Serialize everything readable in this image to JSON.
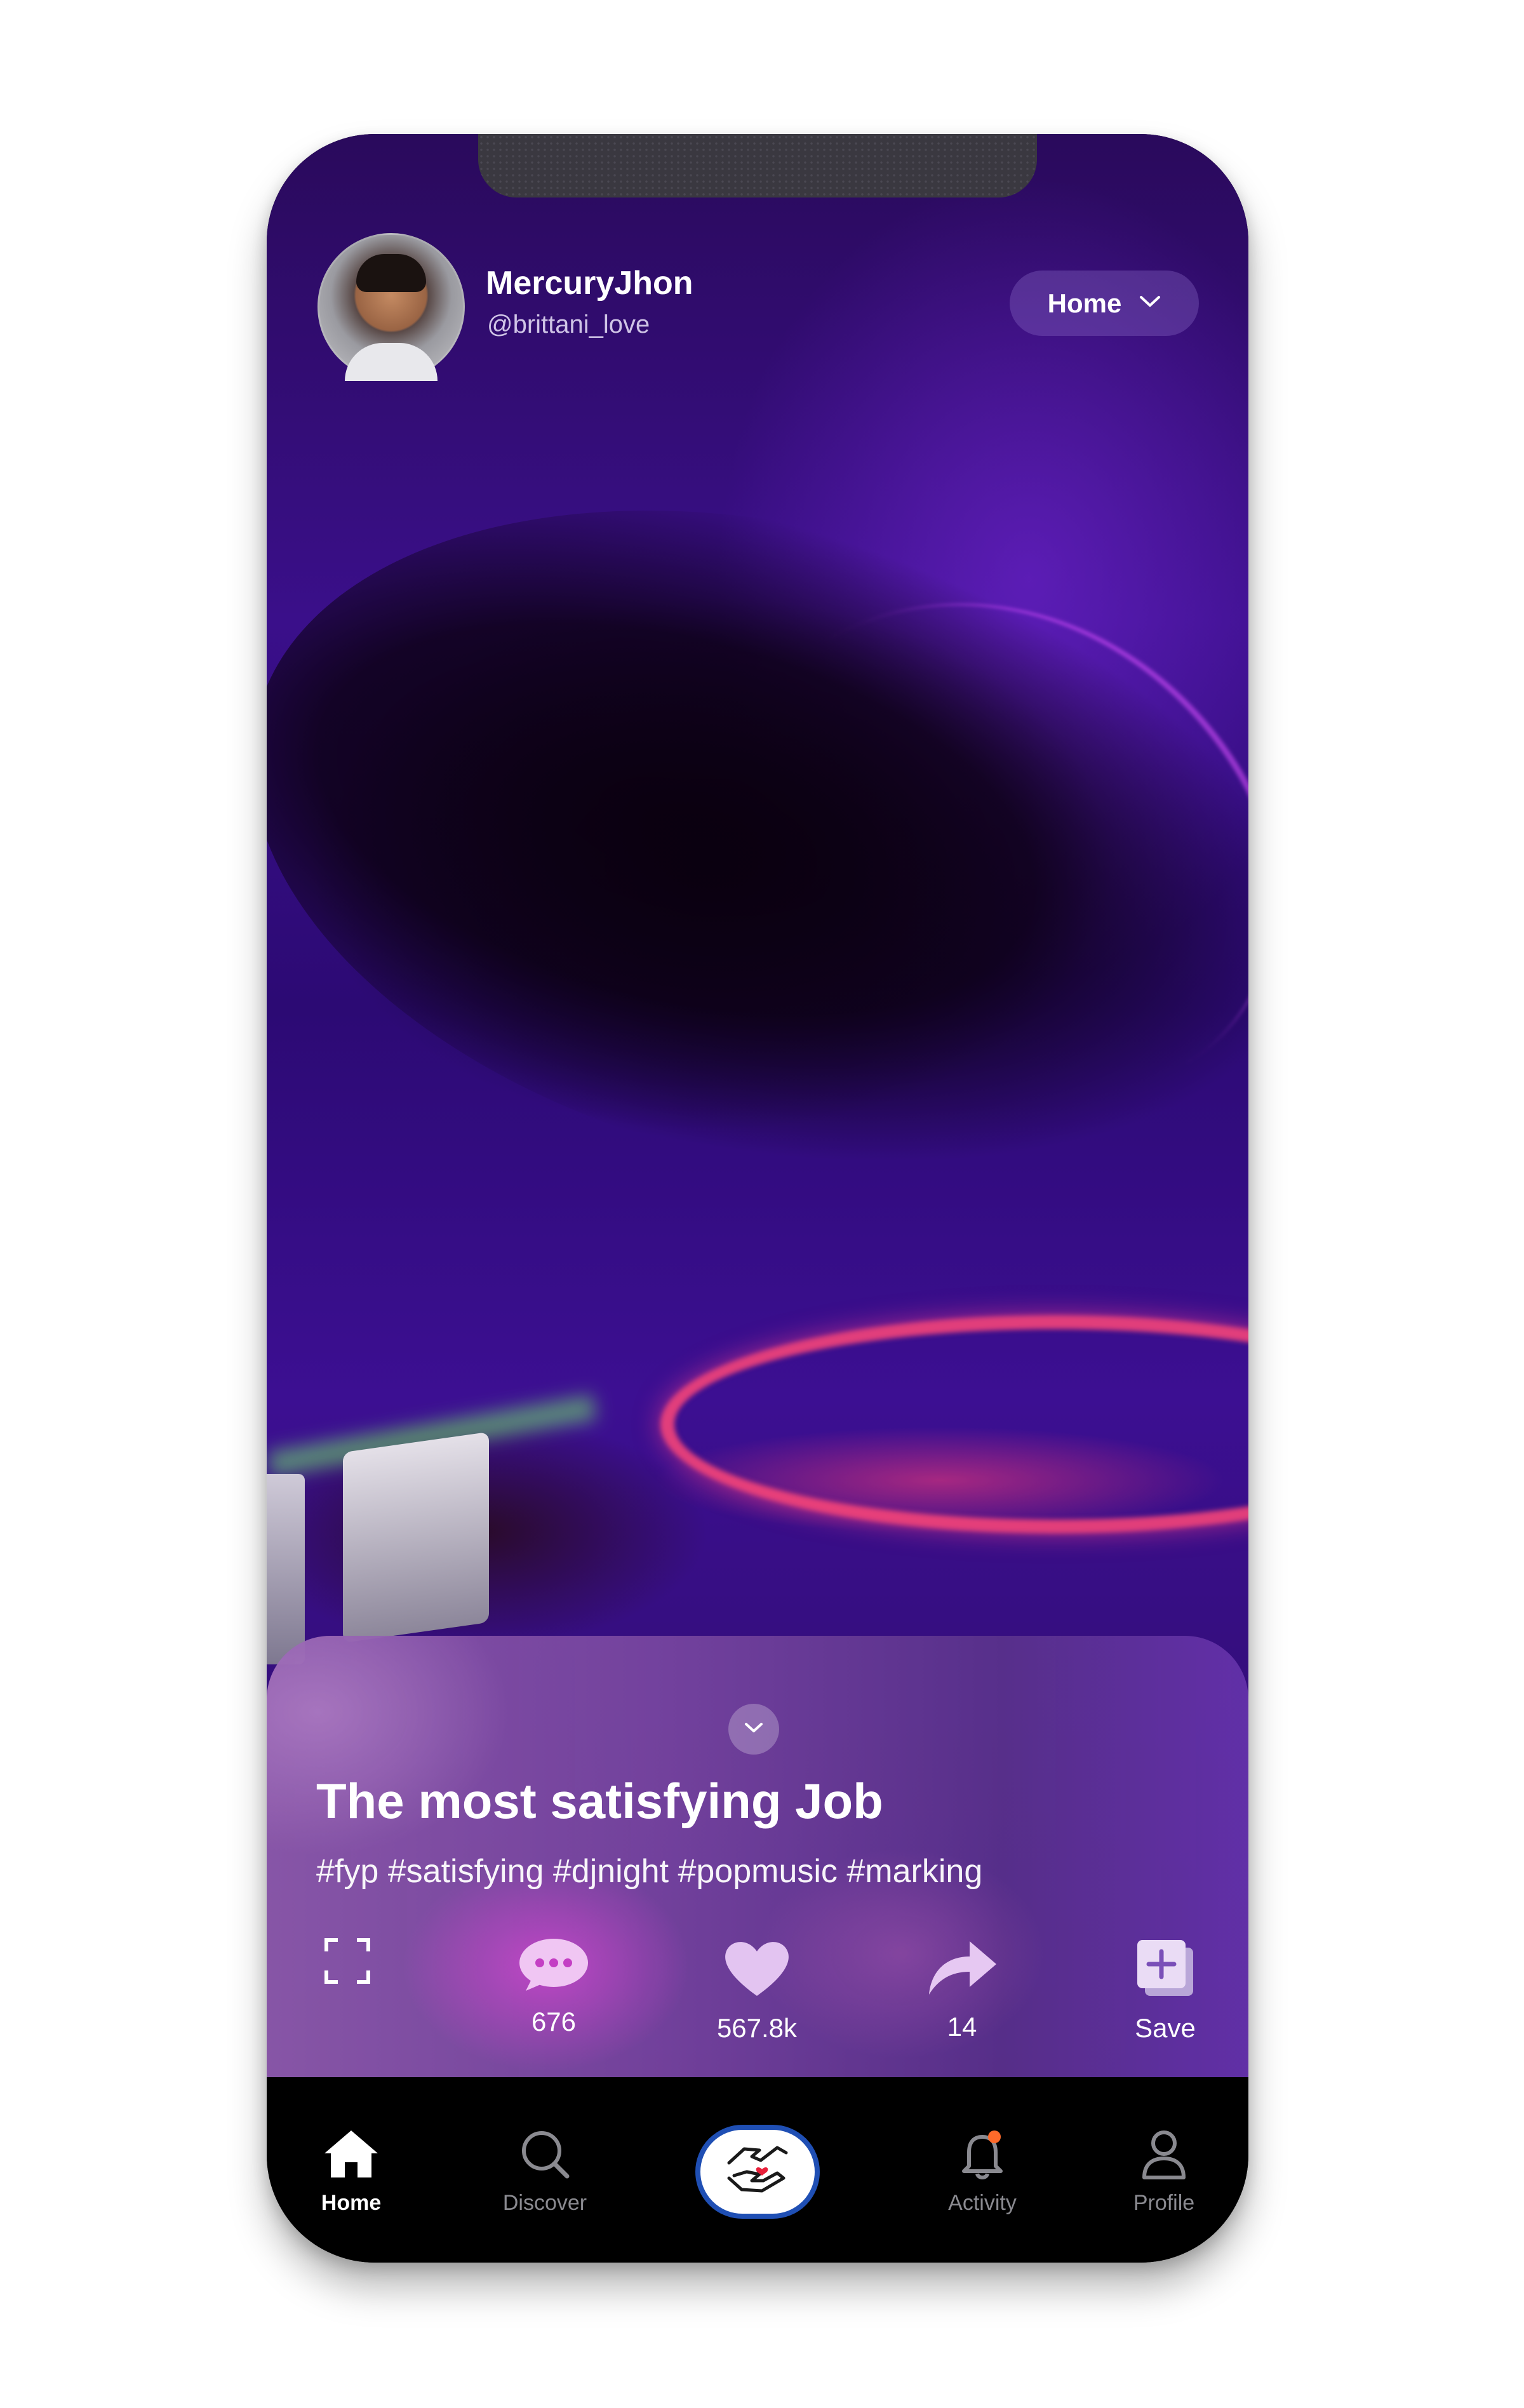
{
  "header": {
    "username": "MercuryJhon",
    "handle": "@brittani_love",
    "feed_selector": {
      "label": "Home"
    }
  },
  "post": {
    "title": "The most satisfying Job",
    "hashtags": "#fyp #satisfying #djnight #popmusic #marking"
  },
  "actions": {
    "fullscreen": {
      "icon": "fullscreen-icon"
    },
    "comments": {
      "icon": "comment-icon",
      "count": "676"
    },
    "likes": {
      "icon": "heart-icon",
      "count": "567.8k"
    },
    "shares": {
      "icon": "share-icon",
      "count": "14"
    },
    "save": {
      "icon": "save-icon",
      "label": "Save"
    }
  },
  "bottom_nav": {
    "home": {
      "label": "Home",
      "icon": "home-icon"
    },
    "discover": {
      "label": "Discover",
      "icon": "search-icon"
    },
    "create": {
      "icon": "hands-heart-icon"
    },
    "activity": {
      "label": "Activity",
      "icon": "bell-icon"
    },
    "profile": {
      "label": "Profile",
      "icon": "person-icon"
    }
  },
  "colors": {
    "accent_blue": "#1f4fb4",
    "video_purple": "#3a0f8a",
    "notification_dot": "#ff6a2a"
  }
}
